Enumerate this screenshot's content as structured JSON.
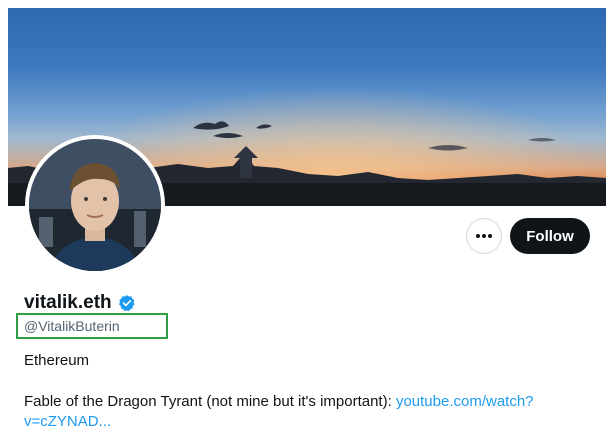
{
  "profile": {
    "display_name": "vitalik.eth",
    "handle": "@VitalikButerin",
    "bio_line1": "Ethereum",
    "bio_line2": "Fable of the Dragon Tyrant (not mine but it's important): ",
    "bio_link": "youtube.com/watch?v=cZYNAD..."
  },
  "actions": {
    "follow_label": "Follow",
    "more_icon": "more-horizontal-icon"
  },
  "icons": {
    "verified": "verified-badge-icon"
  },
  "colors": {
    "link": "#1d9bf0",
    "verified": "#1d9bf0",
    "follow_bg": "#0f1419",
    "highlight_box": "#2ea043"
  }
}
